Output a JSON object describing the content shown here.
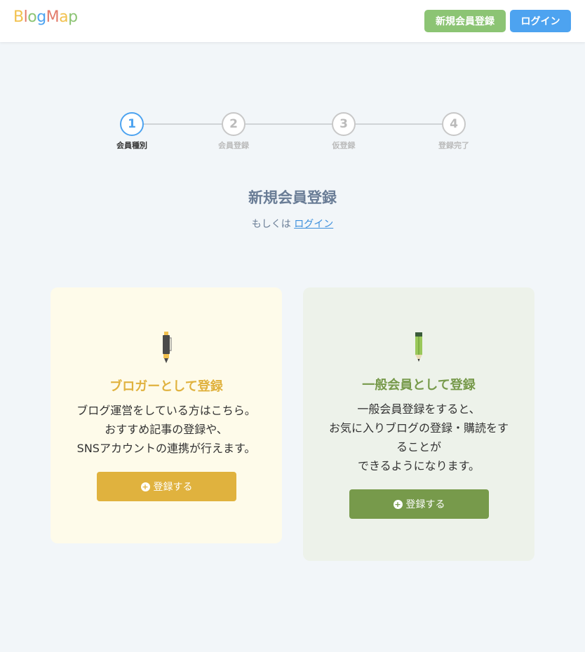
{
  "header": {
    "logo": [
      "B",
      "l",
      "o",
      "g",
      "M",
      "a",
      "p"
    ],
    "logo_colors": [
      "#f2c14e",
      "#e27b6b",
      "#8cc474",
      "#4da3f0",
      "#e27b6b",
      "#f2c14e",
      "#8cc474"
    ],
    "signup_label": "新規会員登録",
    "login_label": "ログイン"
  },
  "stepper": {
    "steps": [
      {
        "number": "1",
        "label": "会員種別"
      },
      {
        "number": "2",
        "label": "会員登録"
      },
      {
        "number": "3",
        "label": "仮登録"
      },
      {
        "number": "4",
        "label": "登録完了"
      }
    ],
    "active": 1
  },
  "main": {
    "title": "新規会員登録",
    "or_text": "もしくは ",
    "login_link": "ログイン"
  },
  "cards": {
    "blogger": {
      "title": "ブロガーとして登録",
      "desc": [
        "ブログ運営をしている方はこちら。",
        "おすすめ記事の登録や、",
        "SNSアカウントの連携が行えます。"
      ],
      "button": "登録する",
      "icon": "pen-icon"
    },
    "general": {
      "title": "一般会員として登録",
      "desc": [
        "一般会員登録をすると、",
        "お気に入りブログの登録・購読をす",
        "ることが",
        "できるようになります。"
      ],
      "button": "登録する",
      "icon": "pencil-icon"
    }
  },
  "colors": {
    "accent_blue": "#4da3f0",
    "accent_green": "#8cc474",
    "blogger_yellow": "#e0b23e",
    "general_green": "#779a4b"
  }
}
